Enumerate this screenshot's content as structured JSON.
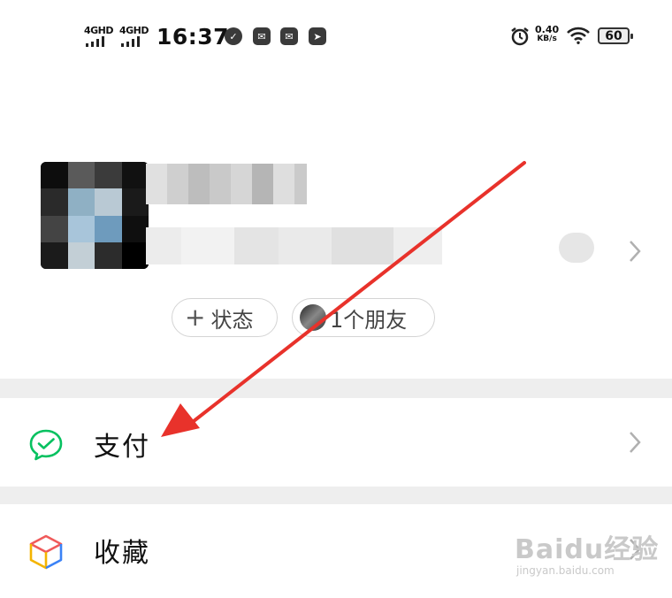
{
  "status_bar": {
    "sim1": "4GHD",
    "sim2": "4GHD",
    "time": "16:37",
    "speed_value": "0.40",
    "speed_unit": "KB/s",
    "battery": "60"
  },
  "profile": {
    "status_chip": "状态",
    "status_plus": "+",
    "friends_chip": "1个朋友"
  },
  "menu": {
    "pay_label": "支付",
    "favorites_label": "收藏"
  },
  "watermark": {
    "brand": "Baidu经验",
    "url": "jingyan.baidu.com"
  },
  "colors": {
    "pay_icon": "#07c160",
    "annotation_arrow": "#e8322b",
    "divider": "#eeeeee"
  }
}
